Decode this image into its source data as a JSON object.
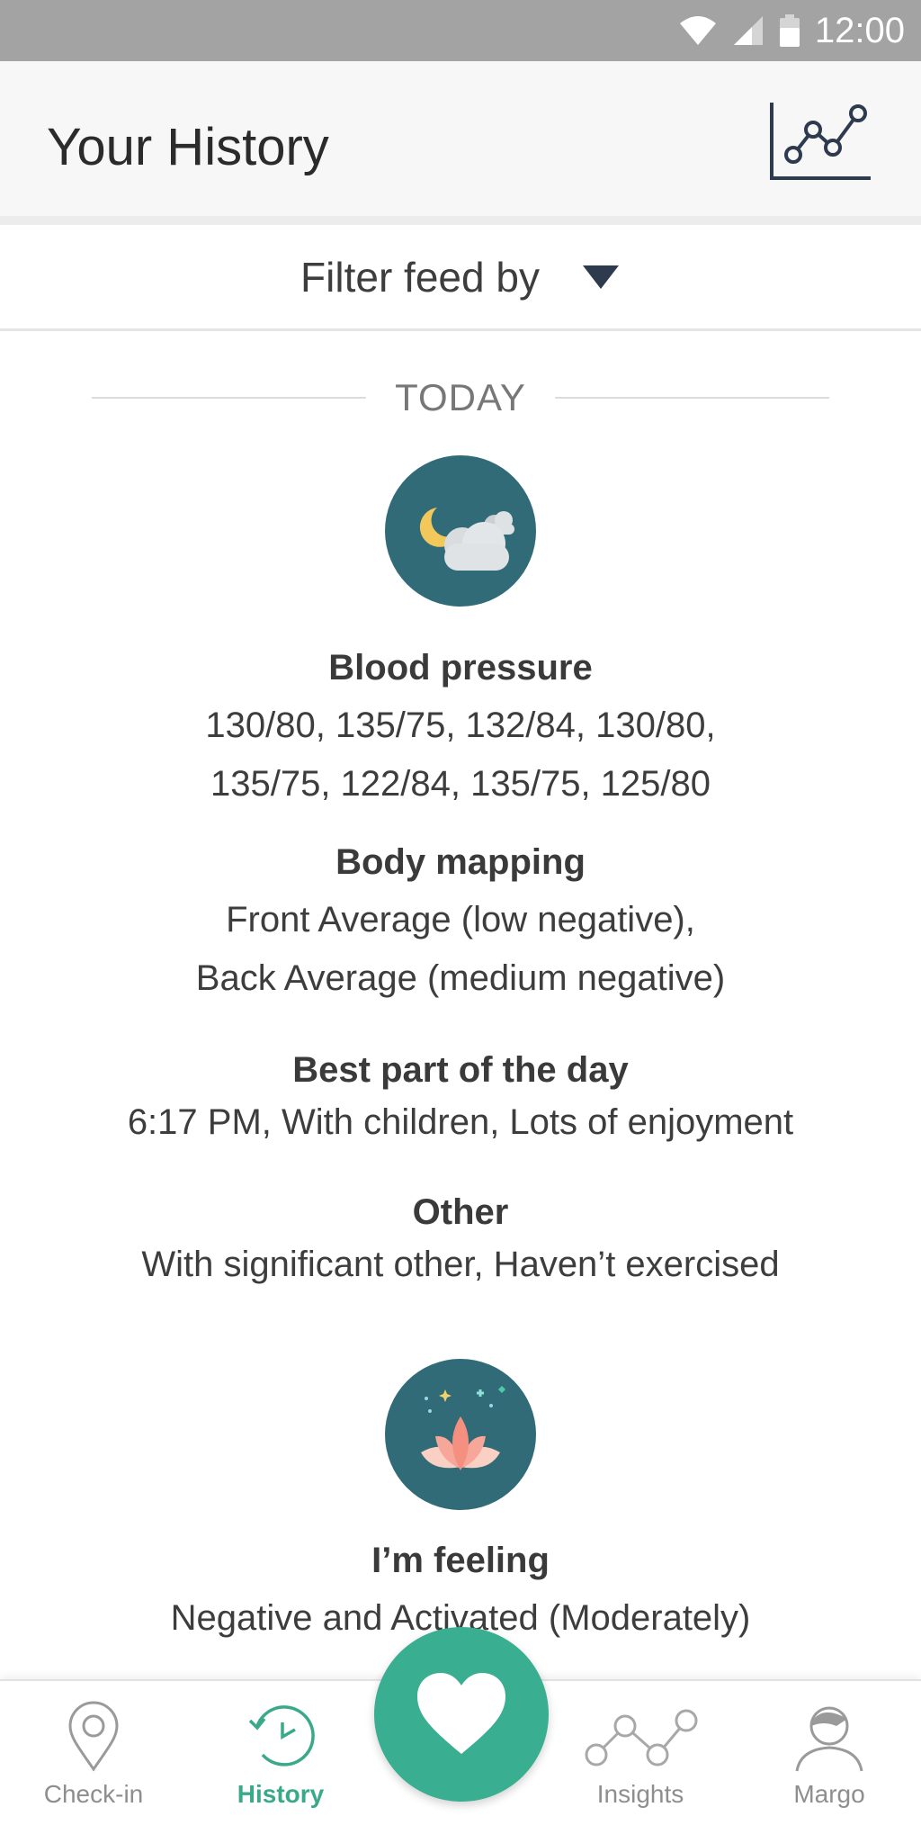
{
  "status_bar": {
    "time": "12:00"
  },
  "header": {
    "title": "Your History"
  },
  "filter": {
    "label": "Filter feed by"
  },
  "feed": {
    "day_label": "TODAY",
    "sections": [
      {
        "heading": "Blood pressure",
        "lines": [
          "130/80, 135/75, 132/84, 130/80,",
          "135/75, 122/84, 135/75, 125/80"
        ]
      },
      {
        "heading": "Body mapping",
        "lines": [
          "Front Average (low negative),",
          "Back Average (medium negative)"
        ]
      },
      {
        "heading": "Best part of the day",
        "lines": [
          "6:17 PM, With children, Lots of enjoyment"
        ]
      },
      {
        "heading": "Other",
        "lines": [
          "With significant other, Haven’t exercised"
        ]
      },
      {
        "heading": "I’m feeling",
        "lines": [
          "Negative and Activated (Moderately)"
        ]
      }
    ]
  },
  "nav": {
    "items": [
      {
        "label": "Check-in",
        "icon": "location-pin-icon"
      },
      {
        "label": "History",
        "icon": "clock-history-icon",
        "active": true
      },
      {
        "label": "Insights",
        "icon": "insights-graph-icon"
      },
      {
        "label": "Margo",
        "icon": "avatar-icon"
      }
    ],
    "fab_icon": "heart-icon"
  },
  "colors": {
    "accent": "#3aae91",
    "icon_circle": "#326b78",
    "status_bar": "#a3a3a3"
  }
}
